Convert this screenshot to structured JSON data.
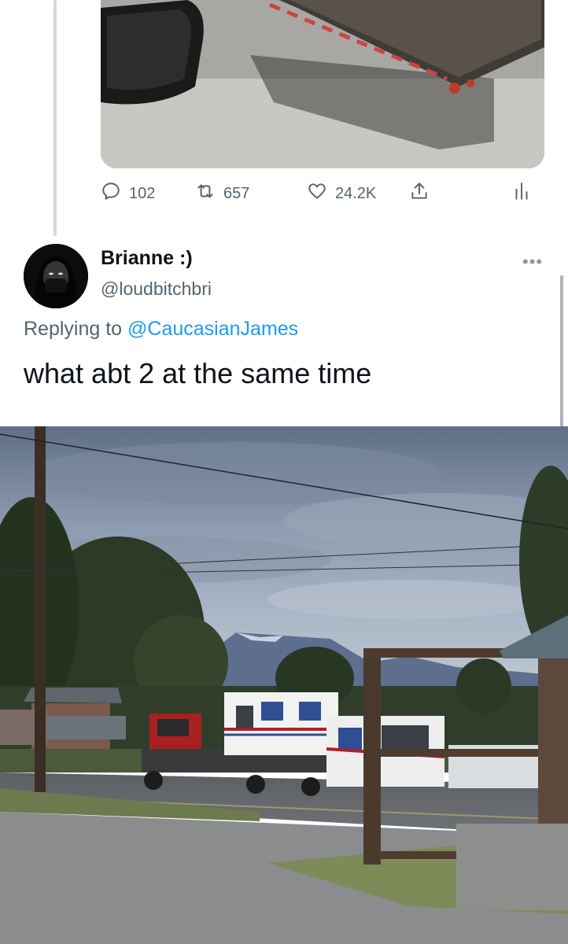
{
  "prev_tweet": {
    "stats": {
      "replies": "102",
      "retweets": "657",
      "likes": "24.2K"
    },
    "icons": [
      "reply-icon",
      "retweet-icon",
      "like-icon",
      "share-icon",
      "analytics-icon"
    ]
  },
  "tweet": {
    "author_name": "Brianne :)",
    "author_handle": "@loudbitchbri",
    "replying_prefix": "Replying to",
    "replying_to": "@CaucasianJames",
    "text": "what abt 2 at the same time",
    "more_icon": "more-icon"
  },
  "colors": {
    "link": "#1d9bf0",
    "muted": "#536471",
    "text": "#0f1419"
  }
}
